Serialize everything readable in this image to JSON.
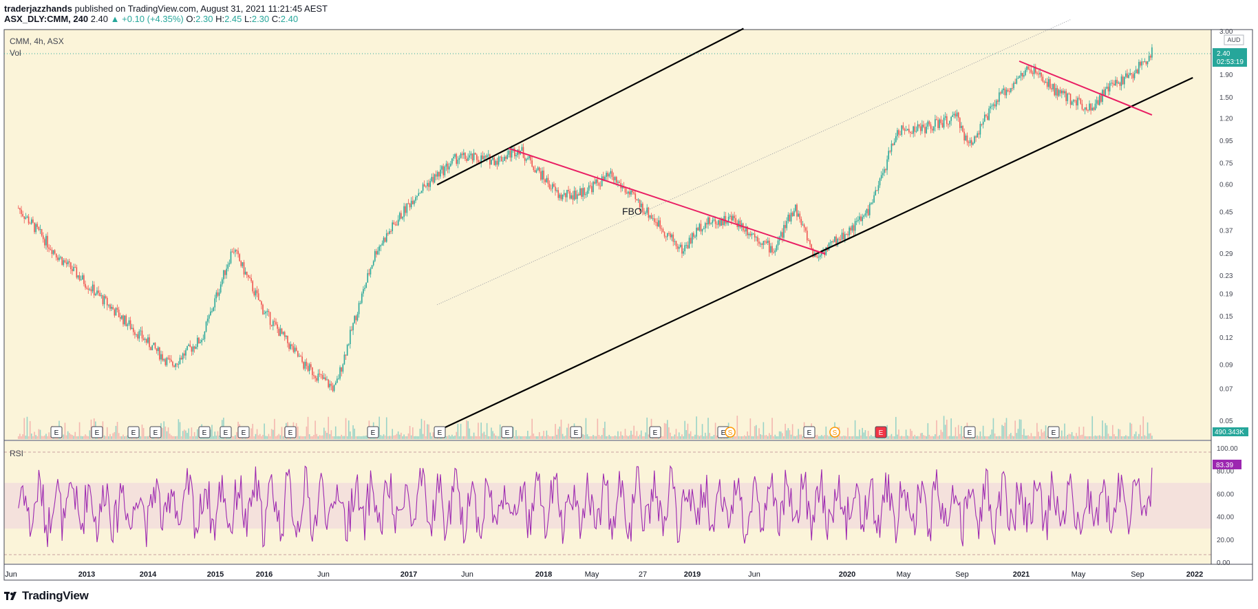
{
  "header": {
    "author": "traderjazzhands",
    "published": "published on TradingView.com, August 31, 2021 11:21:45 AEST",
    "symbol": "ASX_DLY:CMM, 240",
    "last": "2.40",
    "change": "▲ +0.10 (+4.35%)",
    "o_label": "O:",
    "o": "2.30",
    "h_label": "H:",
    "h": "2.45",
    "l_label": "L:",
    "l": "2.30",
    "c_label": "C:",
    "c": "2.40"
  },
  "pane_legend": {
    "main": "CMM, 4h, ASX",
    "vol": "Vol",
    "rsi": "RSI"
  },
  "annotation": "FBO",
  "currency": "AUD",
  "price_tag": {
    "value": "2.40",
    "countdown": "02:53:19"
  },
  "vol_tag": "490.343K",
  "rsi_tag": "83.39",
  "brand": "TradingView",
  "colors": {
    "bg": "#fbf4d9",
    "rsi_bg": "#f4e1dc",
    "up": "#26a69a",
    "down": "#ef5350",
    "trend": "#e91e63",
    "rsi": "#9c27b0",
    "channel": "#000000"
  },
  "chart_data": {
    "type": "candlestick",
    "scale": "log",
    "price_ticks": [
      "3.00",
      "1.90",
      "1.50",
      "1.20",
      "0.95",
      "0.75",
      "0.60",
      "0.45",
      "0.37",
      "0.29",
      "0.23",
      "0.19",
      "0.15",
      "0.12",
      "0.09",
      "0.07",
      "0.05"
    ],
    "rsi_ticks": [
      "100.00",
      "80.00",
      "60.00",
      "40.00",
      "20.00",
      "0.00"
    ],
    "rsi_bands": [
      30,
      70
    ],
    "x_labels": [
      "Jun",
      "2013",
      "2014",
      "2015",
      "2016",
      "Jun",
      "2017",
      "Jun",
      "2018",
      "May",
      "27",
      "2019",
      "Jun",
      "2020",
      "May",
      "Sep",
      "2021",
      "May",
      "Sep",
      "2022"
    ],
    "events": [
      "E",
      "E",
      "E",
      "E",
      "E",
      "E",
      "E",
      "E",
      "E",
      "E",
      "E",
      "E",
      "E",
      "E",
      "S",
      "E",
      "S",
      "E",
      "E",
      "E"
    ],
    "price_path": [
      [
        "2012-06",
        0.47
      ],
      [
        "2012-10",
        0.28
      ],
      [
        "2013-04",
        0.15
      ],
      [
        "2013-09",
        0.09
      ],
      [
        "2013-12",
        0.12
      ],
      [
        "2014-03",
        0.31
      ],
      [
        "2014-06",
        0.16
      ],
      [
        "2014-10",
        0.09
      ],
      [
        "2015-01",
        0.07
      ],
      [
        "2015-03",
        0.15
      ],
      [
        "2015-05",
        0.3
      ],
      [
        "2015-09",
        0.55
      ],
      [
        "2016-01",
        0.8
      ],
      [
        "2016-05",
        0.78
      ],
      [
        "2016-07",
        0.88
      ],
      [
        "2016-11",
        0.53
      ],
      [
        "2017-01",
        0.55
      ],
      [
        "2017-04",
        0.66
      ],
      [
        "2017-08",
        0.43
      ],
      [
        "2017-11",
        0.3
      ],
      [
        "2018-01",
        0.4
      ],
      [
        "2018-04",
        0.42
      ],
      [
        "2018-08",
        0.3
      ],
      [
        "2018-10",
        0.48
      ],
      [
        "2018-12",
        0.28
      ],
      [
        "2019-03",
        0.36
      ],
      [
        "2019-05",
        0.44
      ],
      [
        "2019-06",
        0.55
      ],
      [
        "2019-08",
        1.05
      ],
      [
        "2019-11",
        1.1
      ],
      [
        "2020-02",
        1.22
      ],
      [
        "2020-03",
        0.9
      ],
      [
        "2020-06",
        1.5
      ],
      [
        "2020-09",
        2.05
      ],
      [
        "2020-12",
        1.55
      ],
      [
        "2021-03",
        1.35
      ],
      [
        "2021-05",
        1.7
      ],
      [
        "2021-07",
        1.9
      ],
      [
        "2021-09",
        2.4
      ]
    ],
    "trendlines": [
      {
        "name": "",
        "from": [
          "2016-06",
          0.88
        ],
        "to": [
          "2019-01",
          0.29
        ]
      },
      {
        "name": "",
        "from": [
          "2020-08",
          2.2
        ],
        "to": [
          "2021-09",
          1.25
        ]
      }
    ],
    "channel": {
      "upper": [
        [
          "2015-11",
          0.6
        ],
        [
          "2018-05",
          3.1
        ]
      ],
      "lower": [
        [
          "2015-11",
          0.045
        ],
        [
          "2022-01",
          1.85
        ]
      ]
    }
  }
}
